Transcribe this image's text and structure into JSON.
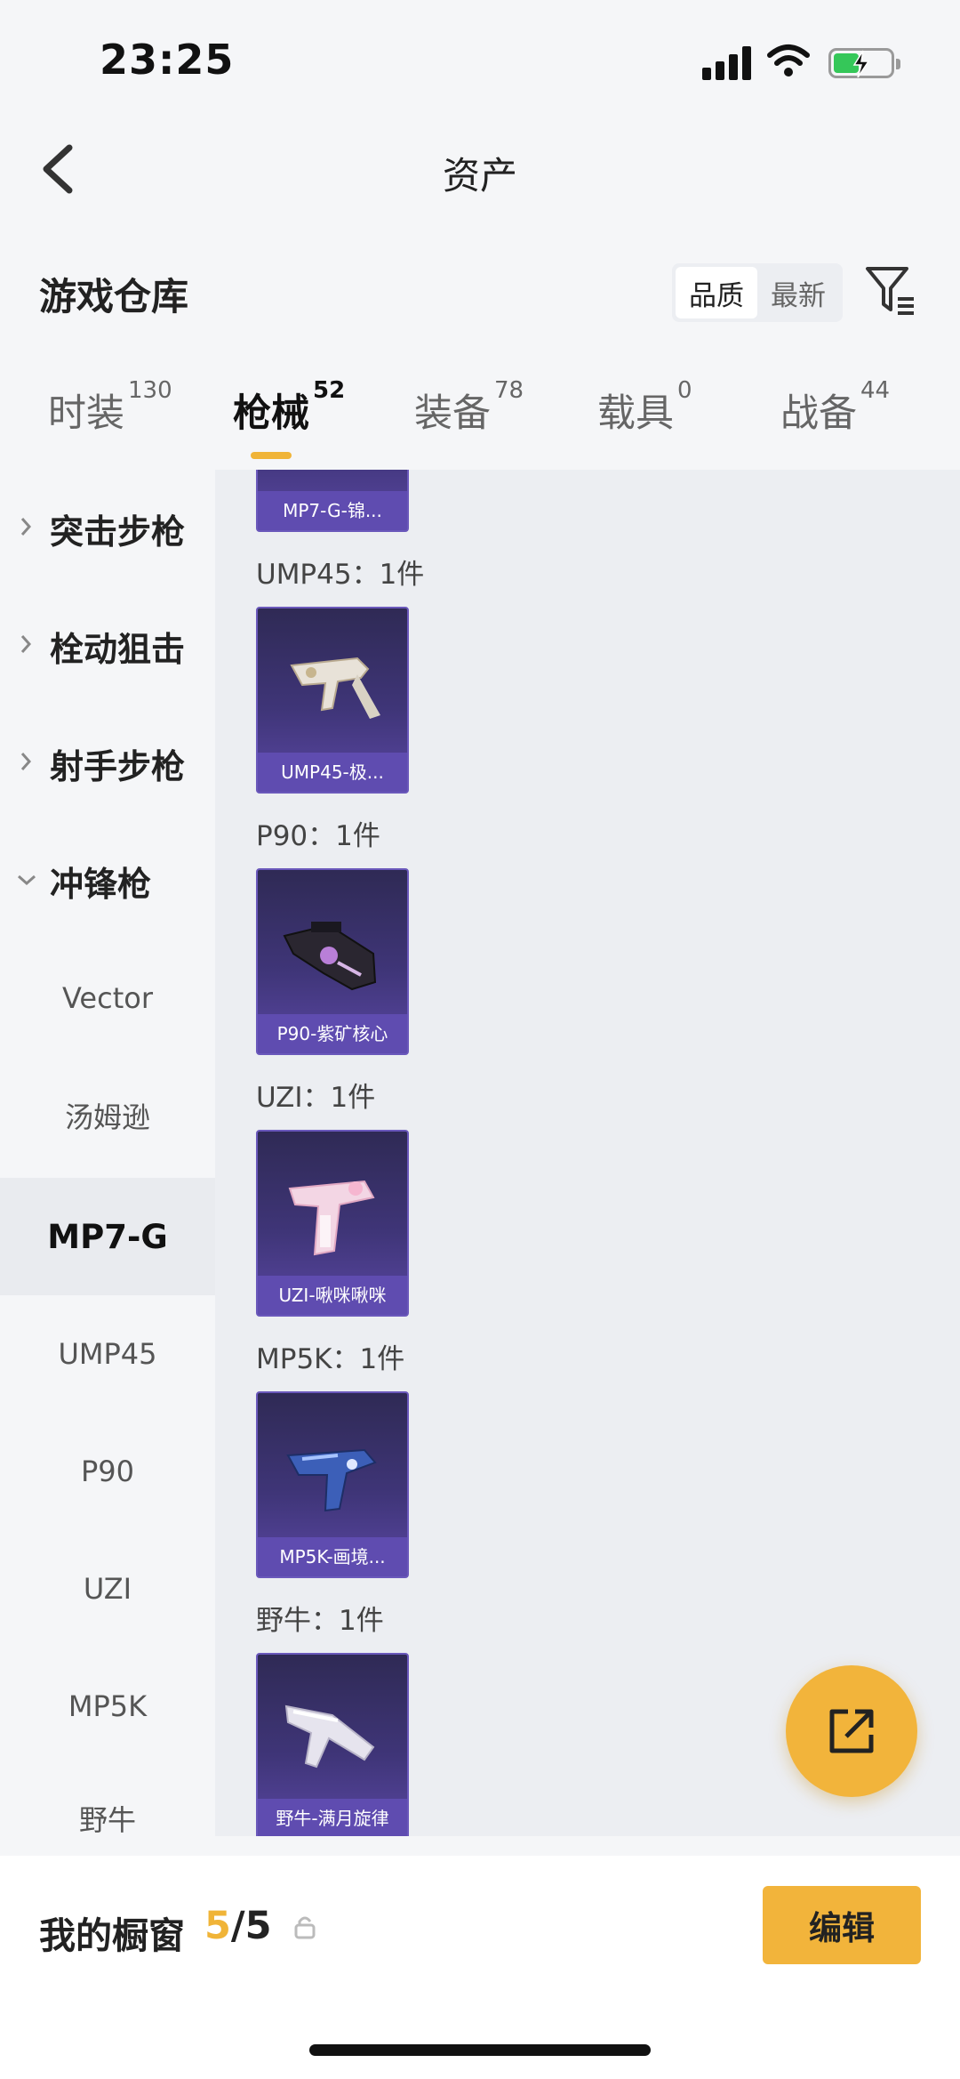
{
  "status": {
    "time": "23:25"
  },
  "nav": {
    "title": "资产"
  },
  "warehouse": {
    "title": "游戏仓库",
    "sort_options": [
      "品质",
      "最新"
    ],
    "sort_selected": "品质"
  },
  "tabs": [
    {
      "label": "时装",
      "count": "130"
    },
    {
      "label": "枪械",
      "count": "52"
    },
    {
      "label": "装备",
      "count": "78"
    },
    {
      "label": "载具",
      "count": "0"
    },
    {
      "label": "战备",
      "count": "44"
    }
  ],
  "active_tab": "枪械",
  "sidebar": {
    "categories": [
      "突击步枪",
      "栓动狙击",
      "射手步枪",
      "冲锋枪"
    ],
    "sub_items": [
      "Vector",
      "汤姆逊",
      "MP7-G",
      "UMP45",
      "P90",
      "UZI",
      "MP5K",
      "野牛"
    ],
    "selected": "MP7-G"
  },
  "content": {
    "top_card_caption": "MP7-G-锦...",
    "groups": [
      {
        "label": "UMP45：1件",
        "caption": "UMP45-极..."
      },
      {
        "label": "P90：1件",
        "caption": "P90-紫矿核心"
      },
      {
        "label": "UZI：1件",
        "caption": "UZI-啾咪啾咪"
      },
      {
        "label": "MP5K：1件",
        "caption": "MP5K-画境..."
      },
      {
        "label": "野牛：1件",
        "caption": "野牛-满月旋律"
      }
    ]
  },
  "bottom": {
    "showcase_label": "我的橱窗",
    "showcase_current": "5",
    "showcase_total": "/5",
    "edit_label": "编辑"
  },
  "colors": {
    "accent": "#f2b43b",
    "card_bg": "#3f3578",
    "card_caption": "#5f4cb0"
  }
}
